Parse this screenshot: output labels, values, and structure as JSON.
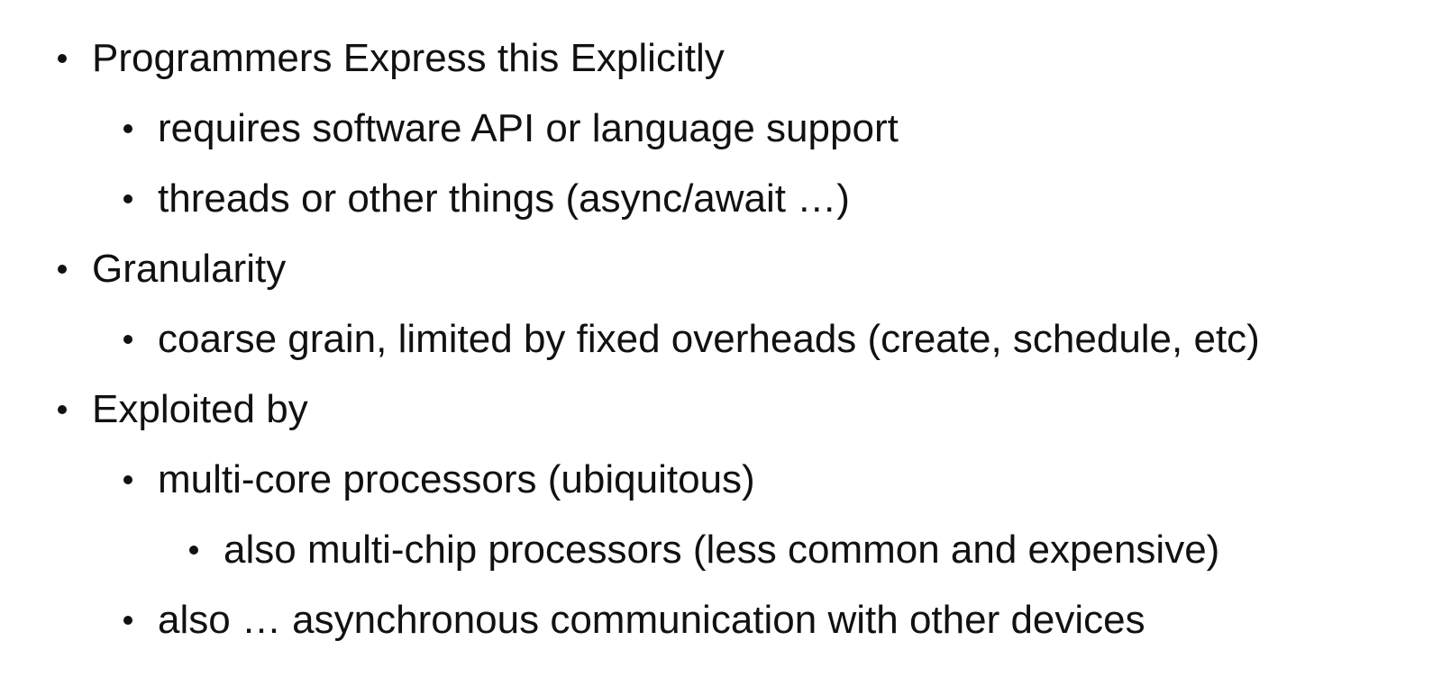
{
  "bullets": [
    {
      "level": 1,
      "text": "Programmers Express this Explicitly"
    },
    {
      "level": 2,
      "text": "requires software API or language support"
    },
    {
      "level": 2,
      "text": "threads or other things (async/await …)"
    },
    {
      "level": 1,
      "text": "Granularity"
    },
    {
      "level": 2,
      "text": "coarse grain, limited by fixed overheads (create, schedule, etc)"
    },
    {
      "level": 1,
      "text": "Exploited by"
    },
    {
      "level": 2,
      "text": "multi-core processors (ubiquitous)"
    },
    {
      "level": 3,
      "text": "also multi-chip processors (less common and expensive)"
    },
    {
      "level": 2,
      "text": "also … asynchronous communication with other devices"
    }
  ]
}
